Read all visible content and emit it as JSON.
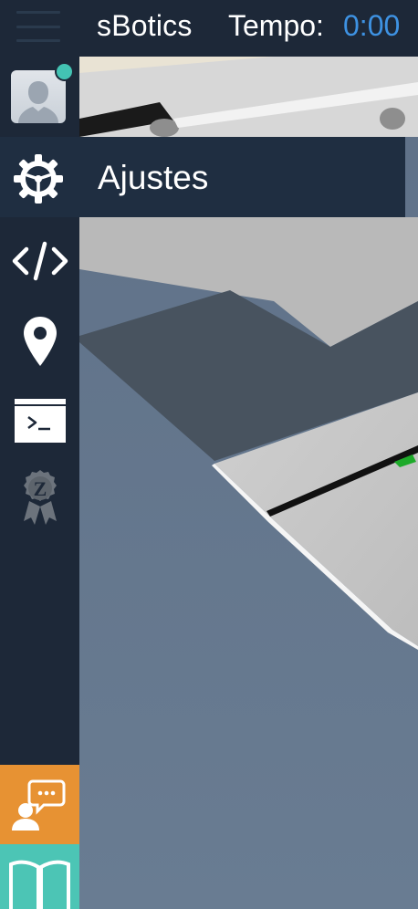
{
  "topbar": {
    "app_title": "sBotics",
    "time_label": "Tempo:",
    "time_value": "0:00",
    "time_color": "#3e92e2"
  },
  "sidebar": {
    "background": "#1d2838",
    "user": {
      "status": "online",
      "status_color": "#43c3b3"
    },
    "settings": {
      "label": "Ajustes",
      "icon": "gear-icon"
    },
    "items": [
      {
        "icon": "code-icon"
      },
      {
        "icon": "location-pin-icon"
      },
      {
        "icon": "terminal-icon"
      },
      {
        "icon": "z-award-badge-icon"
      }
    ],
    "help": {
      "icon": "chat-support-icon",
      "color": "#e79233"
    },
    "docs": {
      "icon": "open-book-icon",
      "color": "#4cc5b5"
    }
  }
}
